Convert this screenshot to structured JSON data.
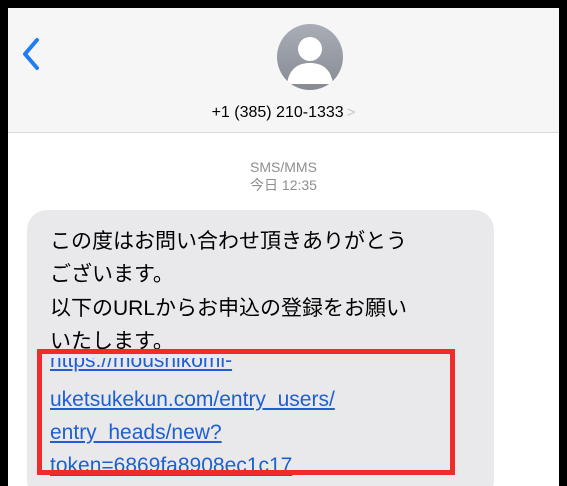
{
  "colors": {
    "link": "#1f5fd1",
    "highlight": "#ef2b2b",
    "bubble": "#e9e9eb",
    "back_chevron": "#1f7cf5"
  },
  "header": {
    "back_icon": "chevron-left-icon",
    "avatar_icon": "person-silhouette-icon",
    "contact": "+1 (385) 210-1333",
    "contact_chevron": ">"
  },
  "thread": {
    "service": "SMS/MMS",
    "timestamp": "今日 12:35"
  },
  "message": {
    "lines": [
      "この度はお問い合わせ頂きありがとう",
      "ございます。",
      "以下のURLからお申込の登録をお願い",
      "いたします。"
    ],
    "link_lines": [
      "https://moushikomi-",
      "uketsukekun.com/entry_users/",
      "entry_heads/new?",
      "token=6869fa8908ec1c17"
    ]
  }
}
